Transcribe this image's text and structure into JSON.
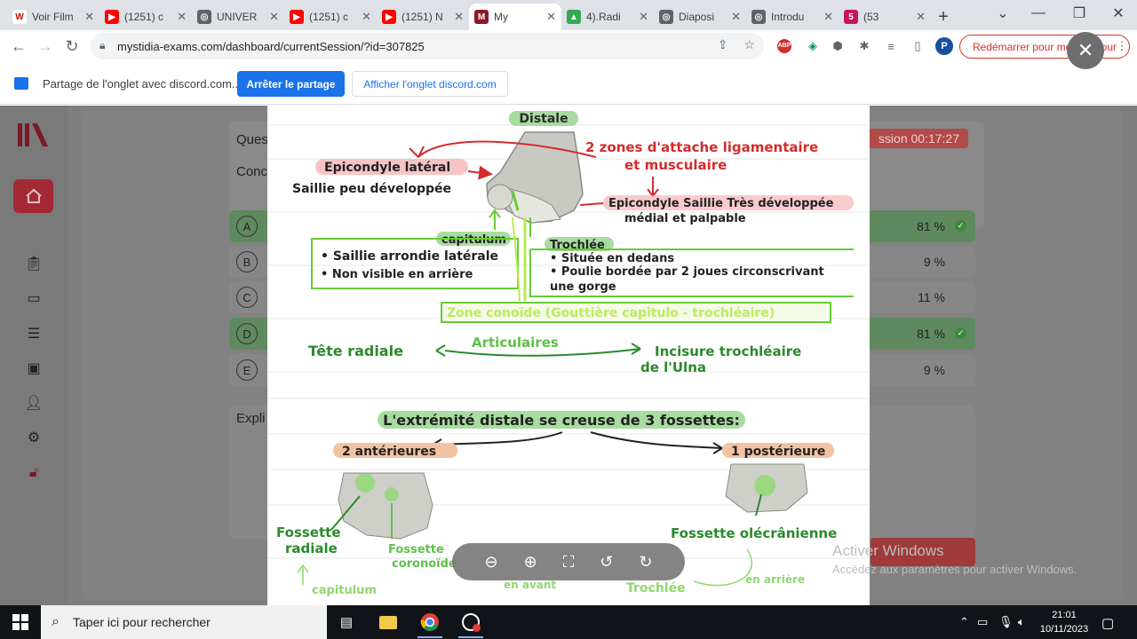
{
  "tabs": [
    {
      "label": "Voir Film",
      "icon": "wikipedia-icon",
      "color": "#fff"
    },
    {
      "label": "(1251) c",
      "icon": "youtube-icon",
      "color": "#ff0000"
    },
    {
      "label": "UNIVER",
      "icon": "globe-icon",
      "color": "#5f6368"
    },
    {
      "label": "(1251) c",
      "icon": "youtube-icon",
      "color": "#ff0000"
    },
    {
      "label": "(1251) N",
      "icon": "youtube-icon",
      "color": "#ff0000"
    },
    {
      "label": "My",
      "icon": "mystidia-icon",
      "color": "#8b1a2b"
    },
    {
      "label": "4).Radi",
      "icon": "drive-icon",
      "color": "#34a853"
    },
    {
      "label": "Diaposi",
      "icon": "globe-icon",
      "color": "#5f6368"
    },
    {
      "label": "Introdu",
      "icon": "globe-icon",
      "color": "#5f6368"
    },
    {
      "label": "(53",
      "icon": "badge-icon",
      "color": "#c2185b"
    }
  ],
  "url": "mystidia-exams.com/dashboard/currentSession/?id=307825",
  "restart_label": "Redémarrer pour mettre à jour",
  "profile_initial": "P",
  "share": {
    "text": "Partage de l'onglet avec discord.com...",
    "stop_label": "Arrêter le partage",
    "show_label": "Afficher l'onglet discord.com"
  },
  "app": {
    "question_label": "Ques",
    "question_sub": "Conc",
    "timer": "ssion 00:17:27",
    "options": [
      {
        "letter": "A",
        "pct": "81 %",
        "correct": true
      },
      {
        "letter": "B",
        "pct": "9 %",
        "correct": false
      },
      {
        "letter": "C",
        "pct": "11 %",
        "correct": false
      },
      {
        "letter": "D",
        "pct": "81 %",
        "correct": true
      },
      {
        "letter": "E",
        "pct": "9 %",
        "correct": false
      }
    ],
    "explication_label": "Expli"
  },
  "slide": {
    "title": "Distale",
    "red_note_1": "2 zones d'attache ligamentaire",
    "red_note_2": "et musculaire",
    "epic_lat_1": "Epicondyle latéral",
    "epic_lat_2": "Saillie peu développée",
    "epic_med_1": "Epicondyle Saillie Très développée",
    "epic_med_2": "médial et palpable",
    "capitulum": "capitulum",
    "cap_b1": "• Saillie arrondie latérale",
    "cap_b2": "• Non visible en arrière",
    "trochlee": "Trochlée",
    "tro_b1": "• Située en dedans",
    "tro_b2": "• Poulie bordée par 2 joues circonscrivant",
    "tro_b3": "une gorge",
    "zone": "Zone conoïde (Gouttière capitulo - trochléaire)",
    "tete": "Tête radiale",
    "articulaires": "Articulaires",
    "incisure_1": "Incisure trochléaire",
    "incisure_2": "de l'Ulna",
    "extremite": "L'extrémité distale se creuse de 3 fossettes:",
    "anterieures": "2 antérieures",
    "posterieure": "1 postérieure",
    "fos_rad_1": "Fossette",
    "fos_rad_2": "radiale",
    "fos_cor_1": "Fossette",
    "fos_cor_2": "coronoïde",
    "fos_ole": "Fossette olécrânienne",
    "bottom_cap": "capitulum",
    "bottom_avant": "en avant",
    "bottom_tro": "Trochlée",
    "bottom_arr": "en arrière"
  },
  "watermark": {
    "line1": "Activer Windows",
    "line2": "Accédez aux paramètres pour activer Windows."
  },
  "taskbar": {
    "search_placeholder": "Taper ici pour rechercher",
    "time": "21:01",
    "date": "10/11/2023"
  }
}
